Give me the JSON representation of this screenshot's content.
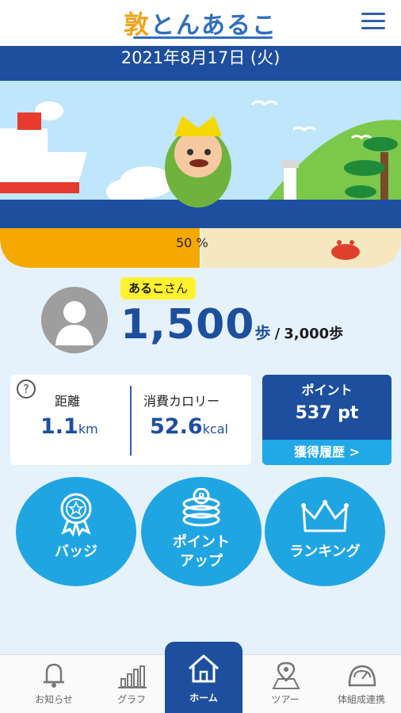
{
  "header": {
    "logo_kanji": "敦",
    "logo_kana": "とんあるこ",
    "menu_icon": "hamburger-menu-icon"
  },
  "date": "2021年8月17日 (火)",
  "progress": {
    "percent_text": "50 %",
    "fraction": 0.5
  },
  "user": {
    "name": "あるこ",
    "suffix": "さん"
  },
  "steps": {
    "count": "1,500",
    "unit": "歩",
    "separator": "/",
    "goal": "3,000歩"
  },
  "stats": {
    "distance_label": "距離",
    "distance_value": "1.1",
    "distance_unit": "km",
    "calorie_label": "消費カロリー",
    "calorie_value": "52.6",
    "calorie_unit": "kcal",
    "help": "?"
  },
  "points": {
    "title": "ポイント",
    "value": "537 pt",
    "history_link": "獲得履歴 >"
  },
  "actions": [
    {
      "label": "バッジ",
      "icon": "badge-medal-icon"
    },
    {
      "label_line1": "ポイント",
      "label_line2": "アップ",
      "icon": "coins-icon"
    },
    {
      "label": "ランキング",
      "icon": "crown-icon"
    }
  ],
  "tabs": [
    {
      "label": "お知らせ",
      "icon": "bell-icon"
    },
    {
      "label": "グラフ",
      "icon": "bar-graph-icon"
    },
    {
      "label": "ホーム",
      "icon": "home-icon",
      "active": true
    },
    {
      "label": "ツアー",
      "icon": "map-pin-icon"
    },
    {
      "label": "体組成連携",
      "icon": "scale-gauge-icon"
    }
  ],
  "colors": {
    "primary": "#1d4f9e",
    "accent": "#20a5e3",
    "highlight": "#fff22e",
    "progress": "#f5a800"
  }
}
